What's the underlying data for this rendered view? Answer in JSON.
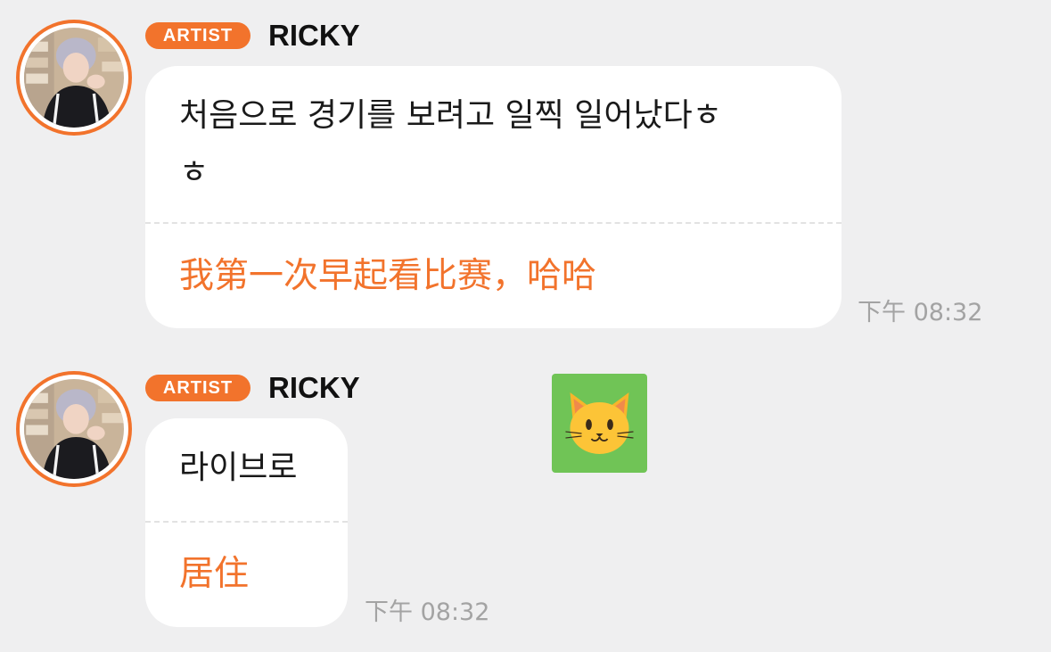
{
  "messages": [
    {
      "badge": "ARTIST",
      "sender": "RICKY",
      "original_line1": "처음으로 경기를 보려고 일찍 일어났다ㅎ",
      "original_line2": "ㅎ",
      "translation": "我第一次早起看比赛，哈哈",
      "time": "下午 08:32"
    },
    {
      "badge": "ARTIST",
      "sender": "RICKY",
      "original_line1": "라이브로",
      "translation": "居住",
      "time": "下午 08:32"
    }
  ],
  "sticker": {
    "icon": "cat-face-emoji",
    "background": "#70c456"
  },
  "colors": {
    "accent": "#f2732c",
    "background": "#efeff0",
    "bubble": "#ffffff",
    "timestamp": "#a3a3a3"
  }
}
